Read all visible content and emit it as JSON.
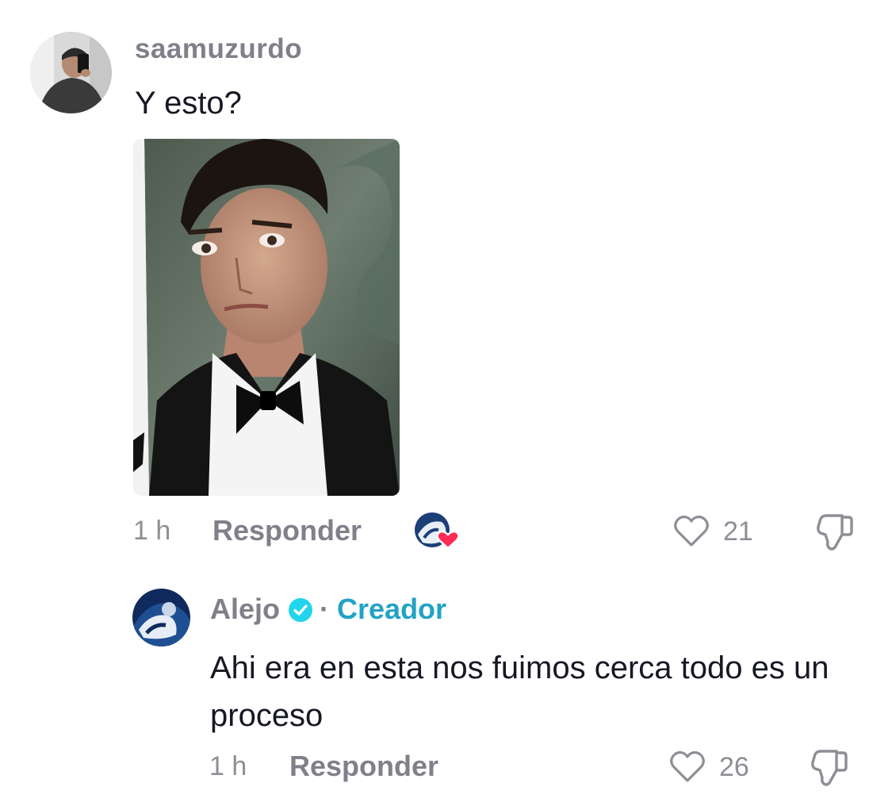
{
  "comments": [
    {
      "username": "saamuzurdo",
      "text": "Y esto?",
      "has_photo": true,
      "time": "1 h",
      "reply_label": "Responder",
      "liked_by_creator": true,
      "likes": "21"
    },
    {
      "username": "Alejo",
      "verified": true,
      "separator": "·",
      "role_badge": "Creador",
      "text": "Ahi era en esta nos fuimos cerca todo es un proceso",
      "time": "1 h",
      "reply_label": "Responder",
      "likes": "26"
    }
  ],
  "colors": {
    "secondary_text": "#80808a",
    "creator_badge": "#21a3c5",
    "verified": "#20d5ec",
    "heart_red": "#fe2c55"
  },
  "icons": {
    "like": "heart-outline-icon",
    "dislike": "thumbs-down-icon",
    "verified": "verified-badge-icon",
    "creator_liked": "creator-heart-icon"
  }
}
